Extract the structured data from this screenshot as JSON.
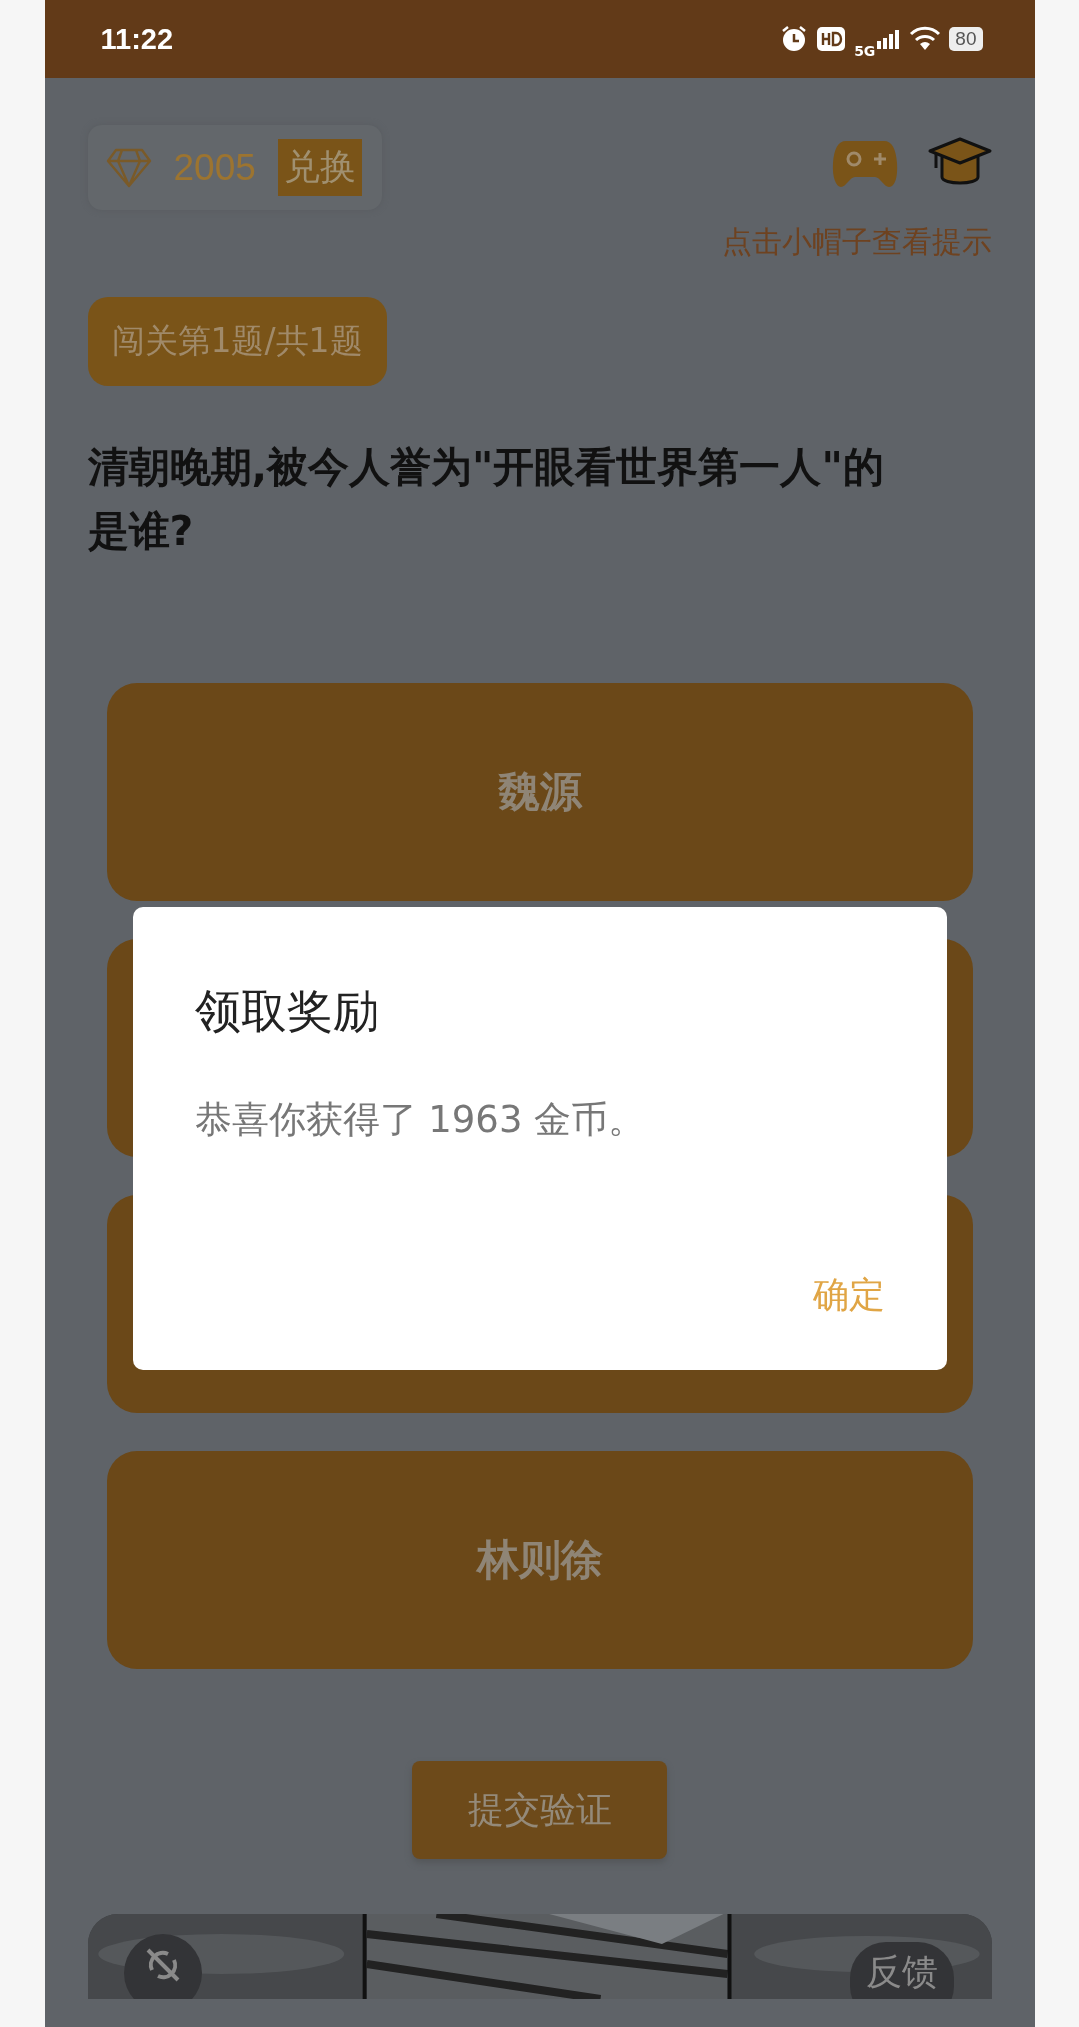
{
  "status_bar": {
    "time": "11:22",
    "network": "5G",
    "battery": "80"
  },
  "header": {
    "diamonds": "2005",
    "exchange_button": "兑换",
    "hint": "点击小帽子查看提示"
  },
  "level_badge": "闯关第1题/共1题",
  "question": "清朝晚期,被今人誉为\"开眼看世界第一人\"的是谁?",
  "options": [
    {
      "kind": "answer",
      "label": "魏源"
    },
    {
      "kind": "covered"
    },
    {
      "kind": "covered"
    },
    {
      "kind": "answer",
      "label": "林则徐"
    }
  ],
  "submit_button": "提交验证",
  "bottom_bar": {
    "feedback_button": "反馈"
  },
  "dialog": {
    "title": "领取奖励",
    "message": "恭喜你获得了 1963 金币。",
    "confirm_button": "确定"
  }
}
